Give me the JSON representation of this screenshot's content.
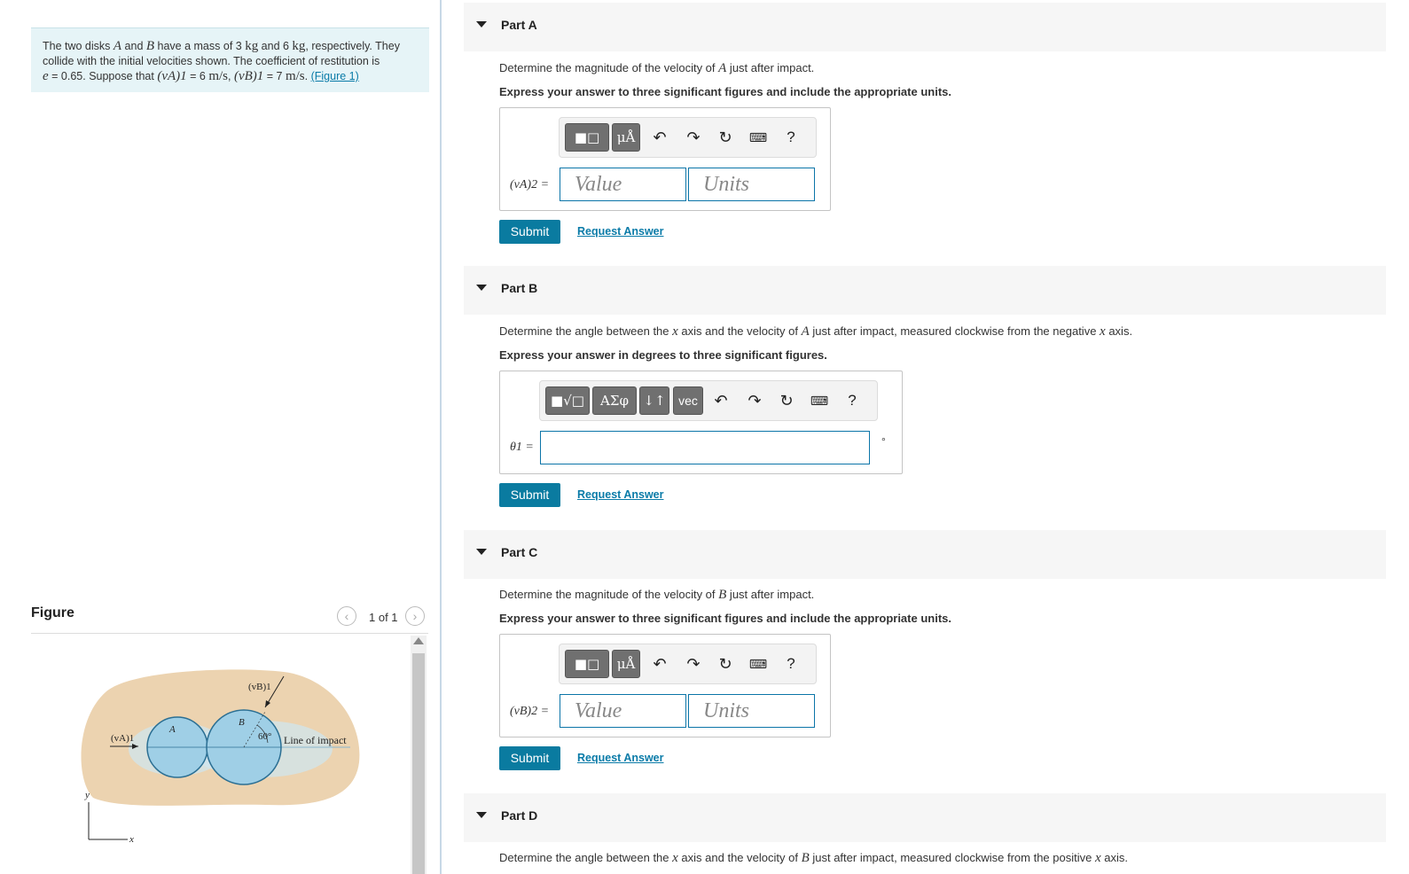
{
  "problem": {
    "text_1": "The two disks ",
    "disk_a": "A",
    "text_2": " and ",
    "disk_b": "B",
    "text_3": " have a mass of 3 ",
    "unit_kg_1": "kg",
    "text_4": " and 6 ",
    "unit_kg_2": "kg",
    "text_5": ", respectively. They collide with the initial velocities shown. The coefficient of restitution is",
    "e_sym": "e",
    "text_6": " = 0.65. Suppose that ",
    "va1": "(vA)1",
    "text_7": " = 6 ",
    "unit_ms_1": "m/s",
    "text_8": ", ",
    "vb1": "(vB)1",
    "text_9": " = 7 ",
    "unit_ms_2": "m/s",
    "text_10": ". ",
    "figure_link": "(Figure 1)"
  },
  "figure": {
    "title": "Figure",
    "counter": "1 of 1",
    "prev_icon": "chevron-left-icon",
    "next_icon": "chevron-right-icon",
    "labels": {
      "vb1": "(vB)1",
      "va1": "(vA)1",
      "a": "A",
      "b": "B",
      "angle": "60°",
      "line_of_impact": "Line of impact",
      "y_axis": "y",
      "x_axis": "x"
    },
    "colors": {
      "background_blob": "#ecd3b0",
      "disk_fill": "#9fcfe6",
      "disk_stroke": "#2b6f93"
    }
  },
  "parts": [
    {
      "title": "Part A",
      "question_1": "Determine the magnitude of the velocity of ",
      "question_var": "A",
      "question_2": " just after impact.",
      "instruction": "Express your answer to three significant figures and include the appropriate units.",
      "label": "(vA)2 =",
      "value_placeholder": "Value",
      "units_placeholder": "Units",
      "submit": "Submit",
      "request": "Request Answer"
    },
    {
      "title": "Part B",
      "question_1": "Determine the angle between the ",
      "question_x1": "x",
      "question_2": " axis and the velocity of ",
      "question_var": "A",
      "question_3": " just after impact, measured clockwise from the negative ",
      "question_x2": "x",
      "question_4": " axis.",
      "instruction": "Express your answer in degrees to three significant figures.",
      "label": "θ1 =",
      "unit_symbol": "°",
      "submit": "Submit",
      "request": "Request Answer"
    },
    {
      "title": "Part C",
      "question_1": "Determine the magnitude of the velocity of ",
      "question_var": "B",
      "question_2": " just after impact.",
      "instruction": "Express your answer to three significant figures and include the appropriate units.",
      "label": "(vB)2 =",
      "value_placeholder": "Value",
      "units_placeholder": "Units",
      "submit": "Submit",
      "request": "Request Answer"
    },
    {
      "title": "Part D",
      "question_1": "Determine the angle between the ",
      "question_x1": "x",
      "question_2": " axis and the velocity of ",
      "question_var": "B",
      "question_3": " just after impact, measured clockwise from the positive ",
      "question_x2": "x",
      "question_4": " axis."
    }
  ],
  "toolbar": {
    "units_btn": "μÅ",
    "greek_btn": "ΑΣφ",
    "arrows_btn": "↓↑",
    "vec_btn": "vec",
    "help": "?",
    "undo_icon": "undo-icon",
    "redo_icon": "redo-icon",
    "reset_icon": "reset-icon",
    "keyboard_icon": "keyboard-icon"
  },
  "colors": {
    "accent": "#0a7ba0",
    "link": "#0a7ba8",
    "problem_bg": "#e6f4f7",
    "header_bg": "#f6f6f6"
  }
}
